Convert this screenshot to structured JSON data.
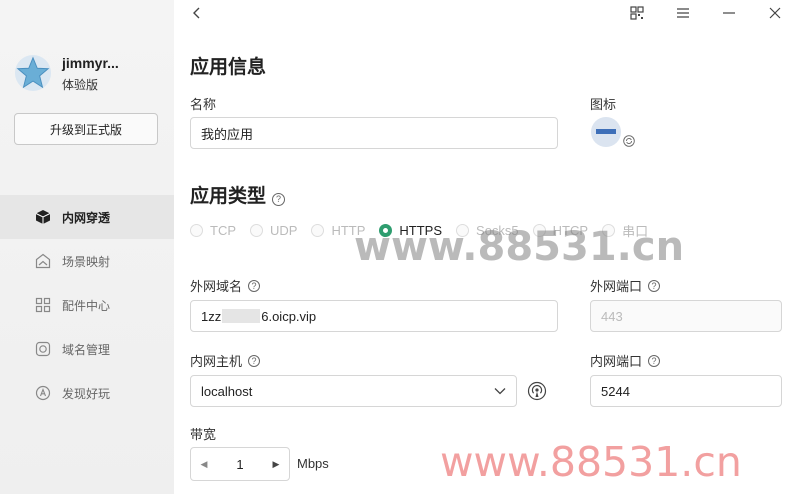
{
  "user": {
    "name": "jimmyr...",
    "plan": "体验版",
    "upgrade_label": "升级到正式版"
  },
  "nav": [
    {
      "label": "内网穿透",
      "icon": "cube-icon",
      "active": true
    },
    {
      "label": "场景映射",
      "icon": "scene-icon",
      "active": false
    },
    {
      "label": "配件中心",
      "icon": "grid-icon",
      "active": false
    },
    {
      "label": "域名管理",
      "icon": "domain-icon",
      "active": false
    },
    {
      "label": "发现好玩",
      "icon": "discover-icon",
      "active": false
    }
  ],
  "titlebar": {
    "back_icon": "chevron-left-icon",
    "qr_icon": "qrcode-icon",
    "menu_icon": "menu-icon",
    "minimize_icon": "minimize-icon",
    "close_icon": "close-icon"
  },
  "app_info": {
    "title": "应用信息",
    "name_label": "名称",
    "name_value": "我的应用",
    "icon_label": "图标"
  },
  "app_type": {
    "title": "应用类型",
    "options": [
      "TCP",
      "UDP",
      "HTTP",
      "HTTPS",
      "Socks5",
      "HTCP",
      "串口"
    ],
    "selected": "HTTPS"
  },
  "form": {
    "domain_label": "外网域名",
    "domain_prefix": "1zz",
    "domain_suffix": "6.oicp.vip",
    "ext_port_label": "外网端口",
    "ext_port_placeholder": "443",
    "host_label": "内网主机",
    "host_value": "localhost",
    "int_port_label": "内网端口",
    "int_port_value": "5244",
    "bandwidth_label": "带宽",
    "bandwidth_value": "1",
    "bandwidth_unit": "Mbps"
  },
  "watermark": {
    "text1": "www.88531.cn",
    "text2": "www.88531.cn"
  },
  "colors": {
    "accent": "#2e9d6f",
    "watermark": "#f2a0a0"
  }
}
